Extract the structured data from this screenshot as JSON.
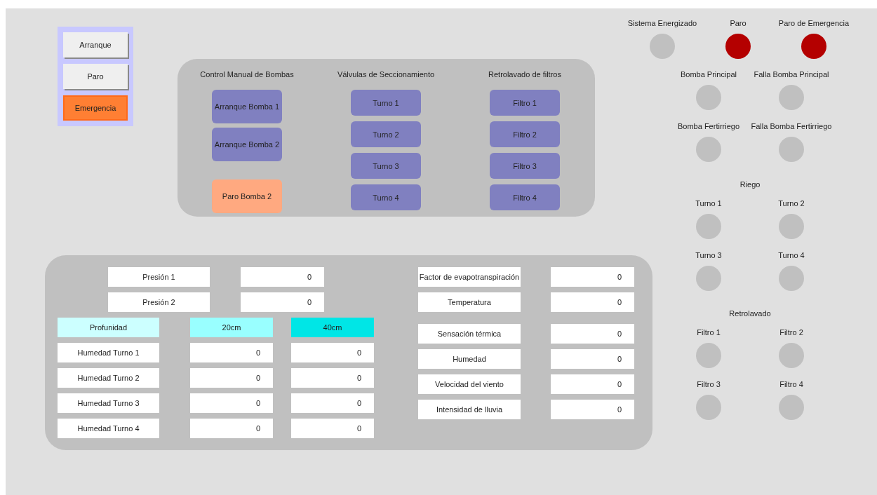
{
  "main_buttons": [
    {
      "label": "Arranque",
      "kind": "normal"
    },
    {
      "label": "Paro",
      "kind": "normal"
    },
    {
      "label": "Emergencia",
      "kind": "emergency"
    }
  ],
  "manual_panel": {
    "columns": [
      {
        "title": "Control Manual de Bombas",
        "buttons": [
          {
            "label": "Arranque Bomba 1",
            "kind": "start"
          },
          {
            "label": "Arranque Bomba 2",
            "kind": "start"
          },
          {
            "label": "Paro Bomba 2",
            "kind": "stop"
          }
        ]
      },
      {
        "title": "Válvulas de Seccionamiento",
        "buttons": [
          {
            "label": "Turno 1",
            "kind": "valve"
          },
          {
            "label": "Turno 2",
            "kind": "valve"
          },
          {
            "label": "Turno 3",
            "kind": "valve"
          },
          {
            "label": "Turno 4",
            "kind": "valve"
          }
        ]
      },
      {
        "title": "Retrolavado de filtros",
        "buttons": [
          {
            "label": "Filtro 1",
            "kind": "valve"
          },
          {
            "label": "Filtro 2",
            "kind": "valve"
          },
          {
            "label": "Filtro 3",
            "kind": "valve"
          },
          {
            "label": "Filtro 4",
            "kind": "valve"
          }
        ]
      }
    ]
  },
  "pressures": [
    {
      "label": "Presión 1",
      "value": "0"
    },
    {
      "label": "Presión 2",
      "value": "0"
    }
  ],
  "moisture": {
    "headers": [
      {
        "text": "Profunidad",
        "color": "#ccffff"
      },
      {
        "text": "20cm",
        "color": "#99ffff"
      },
      {
        "text": "40cm",
        "color": "#00e6e6"
      }
    ],
    "rows": [
      {
        "label": "Humedad Turno 1",
        "values": [
          "0",
          "0"
        ]
      },
      {
        "label": "Humedad Turno 2",
        "values": [
          "0",
          "0"
        ]
      },
      {
        "label": "Humedad Turno 3",
        "values": [
          "0",
          "0"
        ]
      },
      {
        "label": "Humedad Turno 4",
        "values": [
          "0",
          "0"
        ]
      }
    ]
  },
  "weather_groups": [
    [
      {
        "label": "Factor de evapotranspiración",
        "value": "0"
      },
      {
        "label": "Temperatura",
        "value": "0"
      }
    ],
    [
      {
        "label": "Sensación térmica",
        "value": "0"
      },
      {
        "label": "Humedad",
        "value": "0"
      },
      {
        "label": "Velocidad del viento",
        "value": "0"
      },
      {
        "label": "Intensidad de lluvia",
        "value": "0"
      }
    ]
  ],
  "status_lamps": [
    {
      "label": "Sistema Energizado",
      "on": false
    },
    {
      "label": "Paro",
      "on": true
    },
    {
      "label": "Paro de Emergencia",
      "on": true
    }
  ],
  "pump_lamps": [
    {
      "label": "Bomba Principal",
      "on": false
    },
    {
      "label": "Falla Bomba Principal",
      "on": false
    },
    {
      "label": "Bomba Fertirriego",
      "on": false
    },
    {
      "label": "Falla Bomba Fertirriego",
      "on": false
    }
  ],
  "riego": {
    "title": "Riego",
    "lamps": [
      {
        "label": "Turno 1",
        "on": false
      },
      {
        "label": "Turno 2",
        "on": false
      },
      {
        "label": "Turno 3",
        "on": false
      },
      {
        "label": "Turno 4",
        "on": false
      }
    ]
  },
  "retrolavado": {
    "title": "Retrolavado",
    "lamps": [
      {
        "label": "Filtro 1",
        "on": false
      },
      {
        "label": "Filtro 2",
        "on": false
      },
      {
        "label": "Filtro 3",
        "on": false
      },
      {
        "label": "Filtro 4",
        "on": false
      }
    ]
  }
}
